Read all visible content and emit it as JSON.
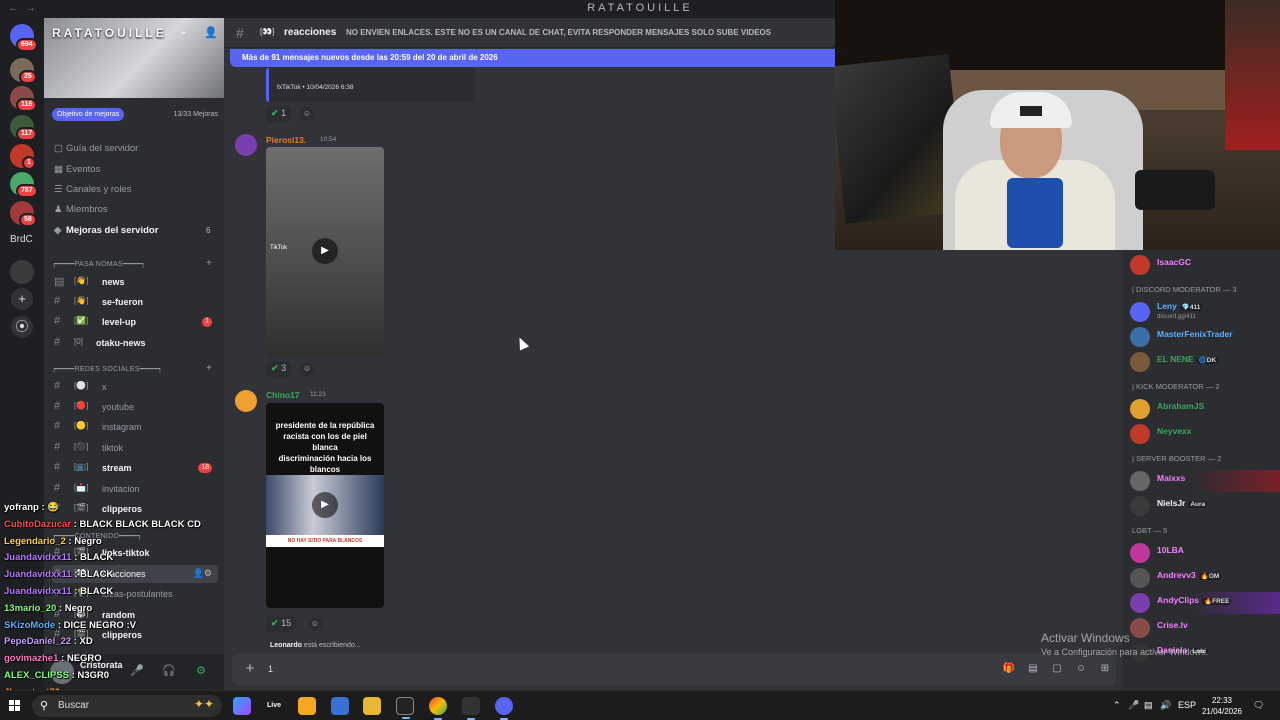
{
  "window": {
    "title": "RATATOUILLE"
  },
  "rail": {
    "badges": [
      "694",
      "25",
      "116",
      "117",
      "1",
      "787",
      "58"
    ],
    "brdc_label": "BrdC"
  },
  "server": {
    "name": "RATATOUILLE",
    "boost_label": "Objetivo de mejoras",
    "boost_count": "13/33 Mejoras",
    "menu": [
      {
        "label": "Guía del servidor"
      },
      {
        "label": "Eventos"
      },
      {
        "label": "Canales y roles"
      },
      {
        "label": "Miembros"
      },
      {
        "label": "Mejoras del servidor",
        "count": "6"
      }
    ],
    "categories": [
      {
        "label": "┍━━━━PASA NOMAS━━━━┑"
      },
      {
        "label": "┍━━━━REDES SOCIALES━━━━┑"
      },
      {
        "label": "┍━━━━CONTENIDO━━━━┑"
      }
    ],
    "channels": [
      {
        "emoji": "[👋]",
        "name": "news"
      },
      {
        "emoji": "[👋]",
        "name": "se-fueron"
      },
      {
        "emoji": "[✅]",
        "name": "level-up",
        "badge": "1"
      },
      {
        "emoji": "[0]",
        "name": "otaku-news"
      },
      {
        "emoji": "[⚪]",
        "name": "x"
      },
      {
        "emoji": "[🔴]",
        "name": "youtube"
      },
      {
        "emoji": "[🟡]",
        "name": "instagram"
      },
      {
        "emoji": "[⚫]",
        "name": "tiktok"
      },
      {
        "emoji": "[📺]",
        "name": "stream",
        "badge": "18"
      },
      {
        "emoji": "[📩]",
        "name": "invitacion"
      },
      {
        "emoji": "[🎬]",
        "name": "clipperos"
      },
      {
        "emoji": "[🎬]",
        "name": "links-tiktok"
      },
      {
        "emoji": "[👀]",
        "name": "reacciones"
      },
      {
        "emoji": "[💡]",
        "name": "ideas-postulantes"
      },
      {
        "emoji": "[🎲]",
        "name": "random"
      },
      {
        "emoji": "[🎬]",
        "name": "clipperos"
      }
    ]
  },
  "stream_chat": [
    {
      "user": "yofranp",
      "text": " : 😂",
      "color": "#ffffff"
    },
    {
      "user": "CubitoDazucar",
      "text": " : BLACK BLACK BLACK CD",
      "color": "#ff4a4a"
    },
    {
      "user": "Legendario_2",
      "text": " : Negro",
      "color": "#ffd24a"
    },
    {
      "user": "Juandavidxx11",
      "text": " : BLACK",
      "color": "#b57bff"
    },
    {
      "user": "Juandavidxx11",
      "text": " : BLACK",
      "color": "#b57bff"
    },
    {
      "user": "Juandavidxx11",
      "text": " : BLACK",
      "color": "#b57bff"
    },
    {
      "user": "13mario_20",
      "text": " : Negro",
      "color": "#7dff7d"
    },
    {
      "user": "SKizoMode",
      "text": " : DICE NEGRO :V",
      "color": "#5ab0ff"
    },
    {
      "user": "PepeDaniel_22",
      "text": " : XD",
      "color": "#c9a0ff"
    },
    {
      "user": "govimazhe1",
      "text": " : NEGRO",
      "color": "#ff7ac0"
    },
    {
      "user": "ALEX_CLIPSS",
      "text": " : N3GR0",
      "color": "#7dff7d"
    },
    {
      "user": "Jhonatant76",
      "text": " : ",
      "color": "#ff9f4a"
    }
  ],
  "user_panel": {
    "name": "Cristorata"
  },
  "header": {
    "channel": "reacciones",
    "channel_emoji": "[👀]",
    "topic": "NO ENVIEN ENLACES. ESTE NO ES UN CANAL DE CHAT, EVITA RESPONDER MENSAJES SOLO SUBE VIDEOS"
  },
  "new_messages_bar": "Más de 91 mensajes nuevos desde las 20:59 del 20 de abril de 2026",
  "messages": [
    {
      "footer": "fxTikTok • 10/04/2026 6:38",
      "reaction_count": "1"
    },
    {
      "user": "Pierosl13.",
      "time": "10:54",
      "user_color": "#e67e22",
      "thumb_label": "TikTok",
      "reaction_count": "3"
    },
    {
      "user": "Chino17",
      "time": "11:23",
      "user_color": "#3ba55c",
      "thumb_lines": [
        "presidente de la república",
        "racista con los de piel",
        "blanca",
        "discriminación hacia los",
        "blancos"
      ],
      "thumb_caption": "NO HAY SITIO PARA BLANCOS",
      "reaction_count": "15"
    }
  ],
  "typing": {
    "user": "Leonardo",
    "text": " está escribiendo..."
  },
  "composer": {
    "value": "1"
  },
  "member_list": {
    "groups": [
      {
        "role": "",
        "members": [
          {
            "name": "IsaacGC",
            "color": "#f47fff"
          }
        ]
      },
      {
        "role": "| DISCORD MODERATOR — 3",
        "members": [
          {
            "name": "Leny",
            "color": "#5ab0ff",
            "tag": "💎411",
            "sub": "discord.gg/411"
          },
          {
            "name": "MasterFenixTrader",
            "color": "#5ab0ff"
          },
          {
            "name": "EL NENE",
            "color": "#3ba55c",
            "tag": "🌀DK"
          }
        ]
      },
      {
        "role": "| KICK MODERATOR — 2",
        "members": [
          {
            "name": "AbrahamJS",
            "color": "#3ba55c"
          },
          {
            "name": "Neyvexx",
            "color": "#3ba55c"
          }
        ]
      },
      {
        "role": "| SERVER BOOSTER — 2",
        "members": [
          {
            "name": "Maixxs",
            "color": "#f47fff"
          },
          {
            "name": "NielsJr",
            "color": "#f2f3f5",
            "tag": "Aura"
          }
        ]
      },
      {
        "role": "LGBT — 5",
        "members": [
          {
            "name": "10LBA",
            "color": "#f47fff"
          },
          {
            "name": "Andrevv3",
            "color": "#f47fff",
            "tag": "🔥OM"
          },
          {
            "name": "AndyClips",
            "color": "#f47fff",
            "tag": "🔥FREE"
          },
          {
            "name": "Crise.lv",
            "color": "#f47fff"
          },
          {
            "name": "Daniela",
            "color": "#f47fff",
            "tag": "Lobi"
          }
        ]
      }
    ]
  },
  "watermark": {
    "title": "Activar Windows",
    "sub": "Ve a Configuración para activar Windows."
  },
  "taskbar": {
    "search_placeholder": "Buscar",
    "apps": [
      "Live"
    ],
    "lang": "ESP",
    "time": "22:33",
    "date": "21/04/2026"
  }
}
